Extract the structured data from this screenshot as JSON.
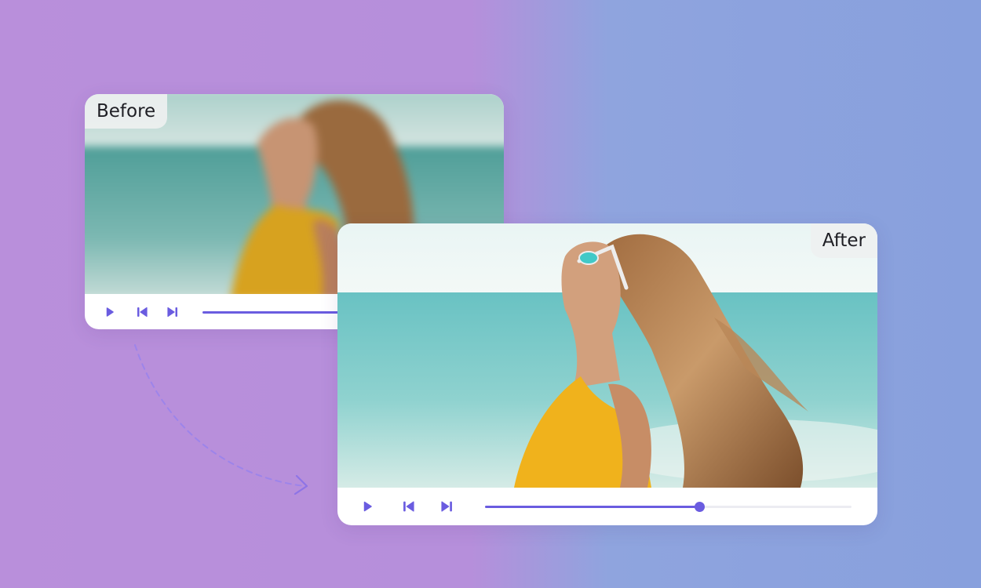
{
  "before_panel": {
    "label": "Before",
    "controls": {
      "play_icon": "play-icon",
      "prev_icon": "skip-back-icon",
      "next_icon": "skip-forward-icon"
    },
    "progress": 1.0
  },
  "after_panel": {
    "label": "After",
    "controls": {
      "play_icon": "play-icon",
      "prev_icon": "skip-back-icon",
      "next_icon": "skip-forward-icon"
    },
    "progress": 0.585
  },
  "colors": {
    "accent": "#6a5ce0",
    "background_left": "#b98fdb",
    "background_right": "#88a0dd",
    "label_background": "#eef0f0"
  },
  "arrow_icon": "dashed-curved-arrow-icon"
}
